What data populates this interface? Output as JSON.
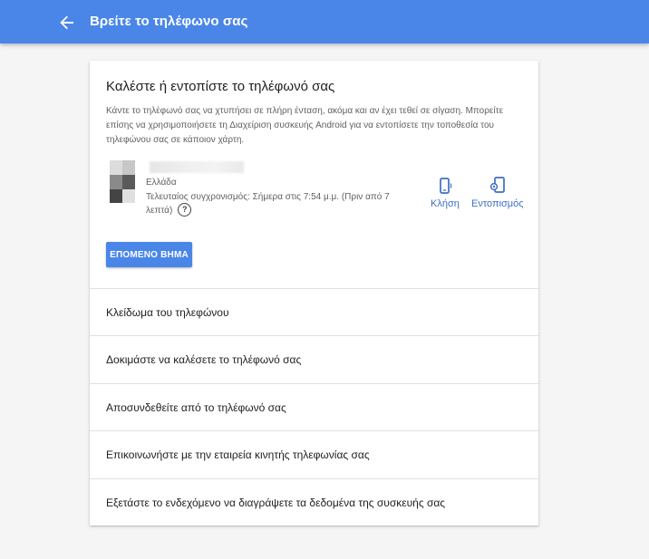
{
  "header": {
    "title": "Βρείτε το τηλέφωνο σας",
    "back_icon": "arrow-back-icon"
  },
  "card": {
    "title": "Καλέστε ή εντοπίστε το τηλέφωνό σας",
    "description": "Κάντε το τηλέφωνό σας να χτυπήσει σε πλήρη ένταση, ακόμα και αν έχει τεθεί σε σίγαση. Μπορείτε επίσης να χρησιμοποιήσετε τη Διαχείριση συσκευής Android για να εντοπίσετε την τοποθεσία του τηλεφώνου σας σε κάποιον χάρτη.",
    "device": {
      "country": "Ελλάδα",
      "sync_text": "Τελευταίος συγχρονισμός: Σήμερα στις 7:54 μ.μ. (Πριν από 7 λεπτά)",
      "help_icon": "help-circle-icon"
    },
    "actions": {
      "call_label": "Κλήση",
      "call_icon": "phone-ring-icon",
      "locate_label": "Εντοπισμός",
      "locate_icon": "phone-locate-icon"
    },
    "next_button": "ΕΠΟΜΕΝΟ ΒΗΜΑ"
  },
  "options": [
    "Κλείδωμα του τηλεφώνου",
    "Δοκιμάστε να καλέσετε το τηλέφωνό σας",
    "Αποσυνδεθείτε από το τηλέφωνό σας",
    "Επικοινωνήστε με την εταιρεία κινητής τηλεφωνίας σας",
    "Εξετάστε το ενδεχόμενο να διαγράψετε τα δεδομένα της συσκευής σας"
  ],
  "colors": {
    "accent": "#4a86e8",
    "link": "#3d6fc4",
    "background": "#f5f5f5"
  }
}
